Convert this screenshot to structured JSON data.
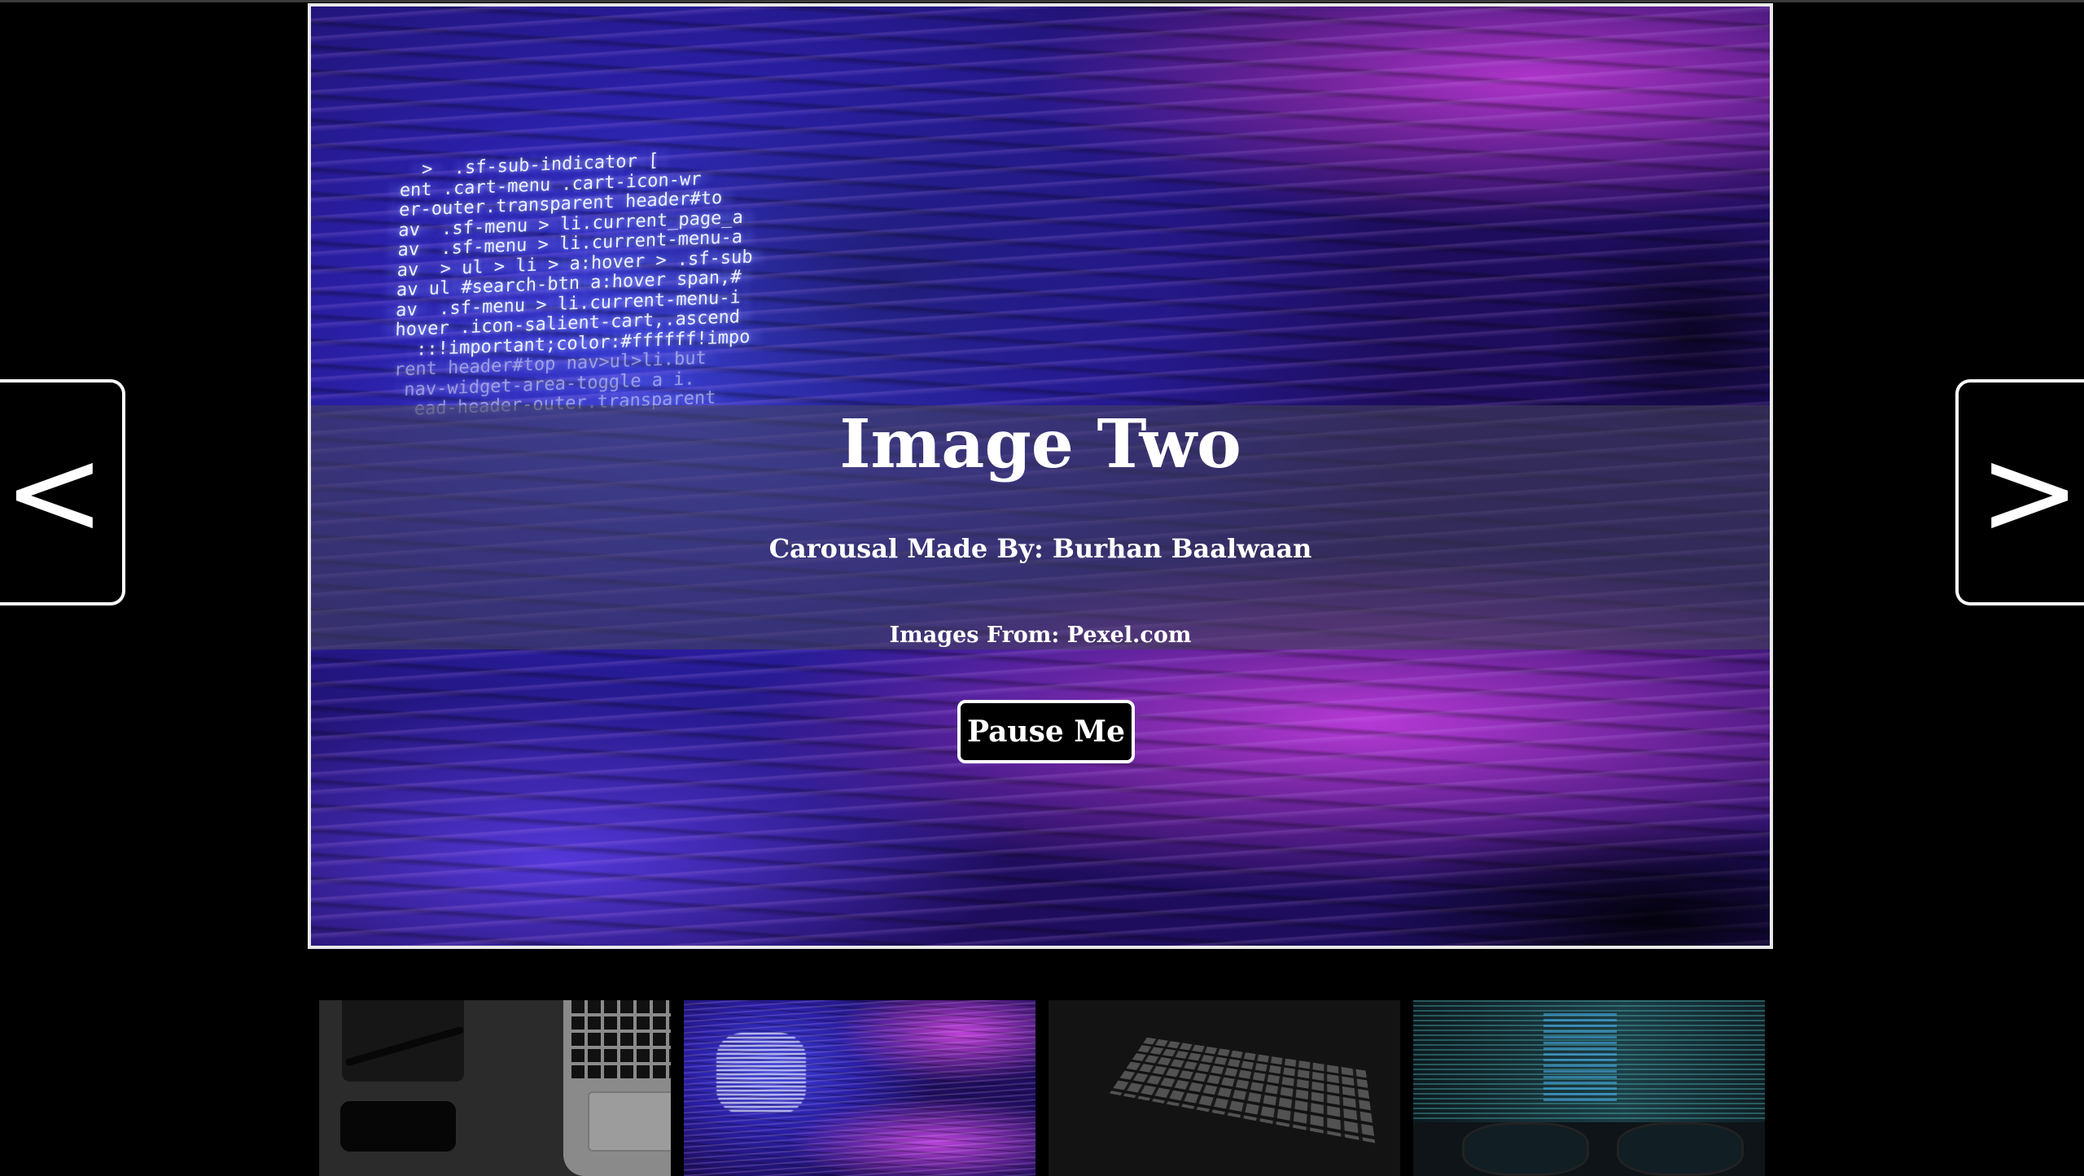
{
  "carousel": {
    "slide": {
      "title": "Image Two",
      "credit": "Carousal Made By: Burhan Baalwaan",
      "source": "Images From: Pexel.com"
    },
    "pause_label": "Pause Me",
    "prev_label": "<",
    "next_label": ">"
  },
  "slide_code_lines": [
    "  >  .sf-sub-indicator [",
    "ent .cart-menu .cart-icon-wr",
    "er-outer.transparent header#to",
    "av  .sf-menu > li.current_page_a",
    "av  .sf-menu > li.current-menu-a",
    "av  > ul > li > a:hover > .sf-sub",
    "av ul #search-btn a:hover span,#",
    "av  .sf-menu > li.current-menu-i",
    "hover .icon-salient-cart,.ascend",
    "  ::!important;color:#ffffff!impo",
    "rent header#top nav>ul>li.but",
    " nav-widget-area-toggle a i.",
    "  ead-header-outer.transparent"
  ],
  "thumbnails": [
    {
      "id": "thumb-1",
      "active": false
    },
    {
      "id": "thumb-2",
      "active": true
    },
    {
      "id": "thumb-3",
      "active": false
    },
    {
      "id": "thumb-4",
      "active": false
    }
  ]
}
